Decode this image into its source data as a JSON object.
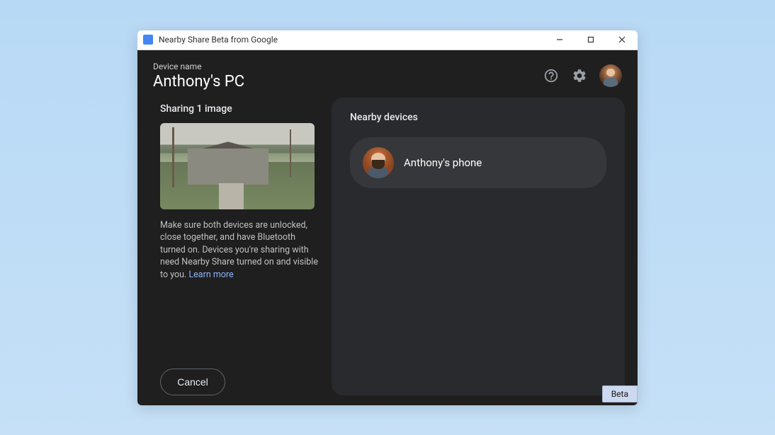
{
  "window": {
    "title": "Nearby Share Beta from Google"
  },
  "header": {
    "device_label": "Device name",
    "device_name": "Anthony's PC"
  },
  "left": {
    "sharing_title": "Sharing 1 image",
    "help_text": "Make sure both devices are unlocked, close together, and have Bluetooth turned on. Devices you're sharing with need Nearby Share turned on and visible to you. ",
    "learn_more": "Learn more",
    "cancel": "Cancel"
  },
  "right": {
    "title": "Nearby devices",
    "devices": [
      {
        "name": "Anthony's phone"
      }
    ]
  },
  "badge": "Beta"
}
